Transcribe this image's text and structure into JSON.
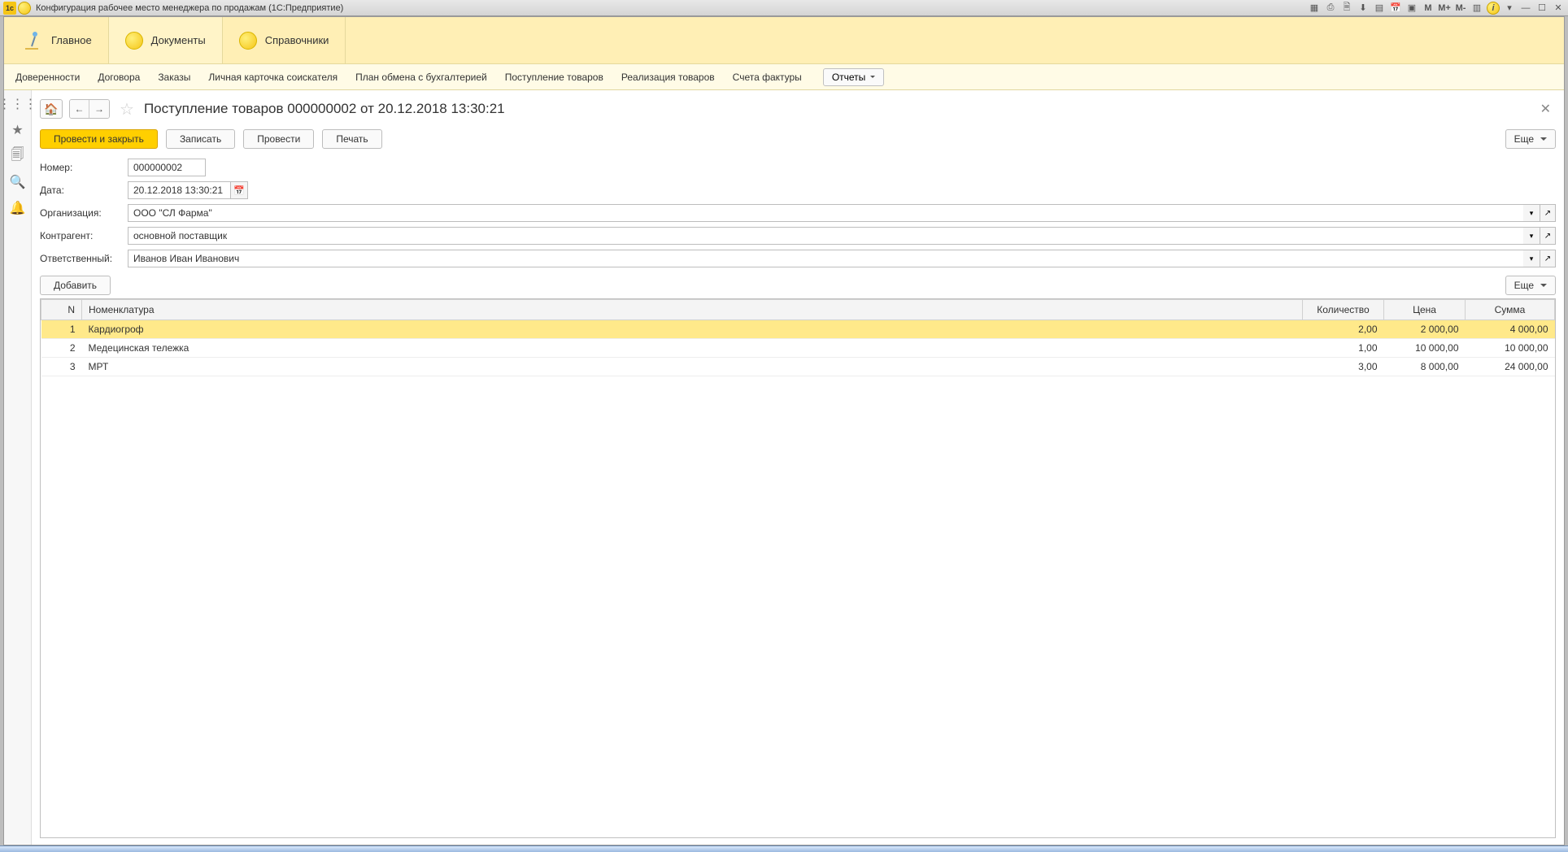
{
  "window_title": "Конфигурация рабочее место менеджера по продажам (1С:Предприятие)",
  "win_buttons": {
    "m": "M",
    "mp": "M+",
    "mm": "M-"
  },
  "toptabs": [
    {
      "label": "Главное"
    },
    {
      "label": "Документы"
    },
    {
      "label": "Справочники"
    }
  ],
  "subnav": {
    "items": [
      "Доверенности",
      "Договора",
      "Заказы",
      "Личная карточка соискателя",
      "План обмена с бухгалтерией",
      "Поступление товаров",
      "Реализация товаров",
      "Счета фактуры"
    ],
    "reports": "Отчеты"
  },
  "page_title": "Поступление товаров 000000002 от 20.12.2018 13:30:21",
  "actions": {
    "post_close": "Провести и закрыть",
    "write": "Записать",
    "post": "Провести",
    "print": "Печать",
    "more": "Еще"
  },
  "form": {
    "number_label": "Номер:",
    "number_value": "000000002",
    "date_label": "Дата:",
    "date_value": "20.12.2018 13:30:21",
    "org_label": "Организация:",
    "org_value": "ООО \"СЛ Фарма\"",
    "contr_label": "Контрагент:",
    "contr_value": "основной поставщик",
    "resp_label": "Ответственный:",
    "resp_value": "Иванов Иван Иванович"
  },
  "tablebar": {
    "add": "Добавить",
    "more": "Еще"
  },
  "table": {
    "headers": {
      "n": "N",
      "nom": "Номенклатура",
      "qty": "Количество",
      "price": "Цена",
      "sum": "Сумма"
    },
    "rows": [
      {
        "n": "1",
        "nom": "Кардиогроф",
        "qty": "2,00",
        "price": "2 000,00",
        "sum": "4 000,00",
        "selected": true
      },
      {
        "n": "2",
        "nom": "Медецинская тележка",
        "qty": "1,00",
        "price": "10 000,00",
        "sum": "10 000,00",
        "selected": false
      },
      {
        "n": "3",
        "nom": "МРТ",
        "qty": "3,00",
        "price": "8 000,00",
        "sum": "24 000,00",
        "selected": false
      }
    ]
  }
}
